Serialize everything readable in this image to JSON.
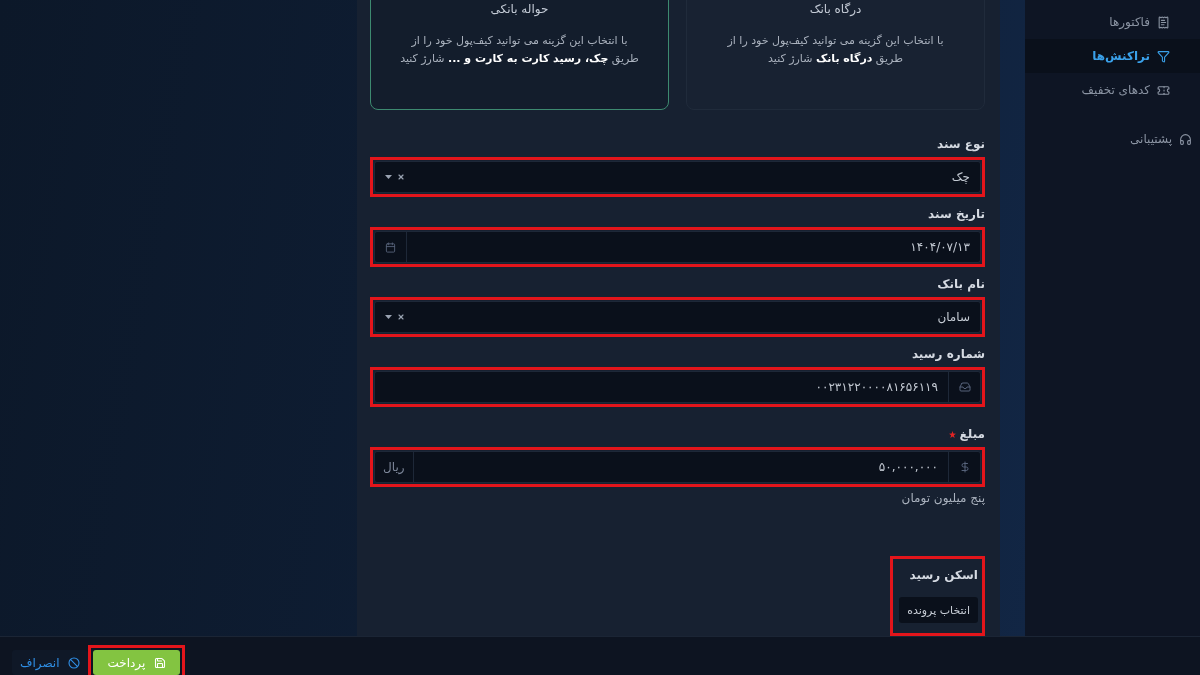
{
  "sidebar": {
    "sub_items": [
      {
        "label": "فاکتورها",
        "selected": false
      },
      {
        "label": "تراکنش‌ها",
        "selected": true
      },
      {
        "label": "کدهای تخفیف",
        "selected": false
      }
    ],
    "items": [
      {
        "label": "پشتیبانی",
        "selected": false
      }
    ]
  },
  "payment_methods": [
    {
      "title": "درگاه بانک",
      "description": "با انتخاب این گزینه می توانید کیف‌پول خود را از طریق **درگاه بانک** شارژ کنید",
      "selected": false
    },
    {
      "title": "حواله بانکی",
      "description": "با انتخاب این گزینه می توانید کیف‌پول خود را از طریق **چک، رسید کارت به کارت و ...** شارژ کنید",
      "selected": true
    }
  ],
  "form": {
    "fields": [
      {
        "kind": "select",
        "label": "نوع سند",
        "required": false,
        "value": "چک",
        "highlighted": true
      },
      {
        "kind": "date",
        "label": "تاریخ سند",
        "required": false,
        "value": "۱۴۰۴/۰۷/۱۳",
        "highlighted": true
      },
      {
        "kind": "select",
        "label": "نام بانک",
        "required": false,
        "value": "سامان",
        "highlighted": true
      },
      {
        "kind": "text",
        "label": "شماره رسید",
        "required": false,
        "value": "۰۰۲۳۱۲۲۰۰۰۰۸۱۶۵۶۱۱۹",
        "highlighted": true
      },
      {
        "kind": "amount",
        "label": "مبلغ",
        "required": true,
        "value": "۵۰,۰۰۰,۰۰۰",
        "suffix": "ریال",
        "help": "پنج میلیون تومان",
        "highlighted": true
      },
      {
        "kind": "file",
        "label": "اسکن رسید",
        "required": false,
        "button": "انتخاب پرونده",
        "highlighted": true
      }
    ]
  },
  "footer": {
    "buttons": [
      {
        "kind": "primary",
        "label": "پرداخت",
        "highlighted": true
      },
      {
        "kind": "link",
        "label": "انصراف",
        "highlighted": false
      }
    ]
  }
}
